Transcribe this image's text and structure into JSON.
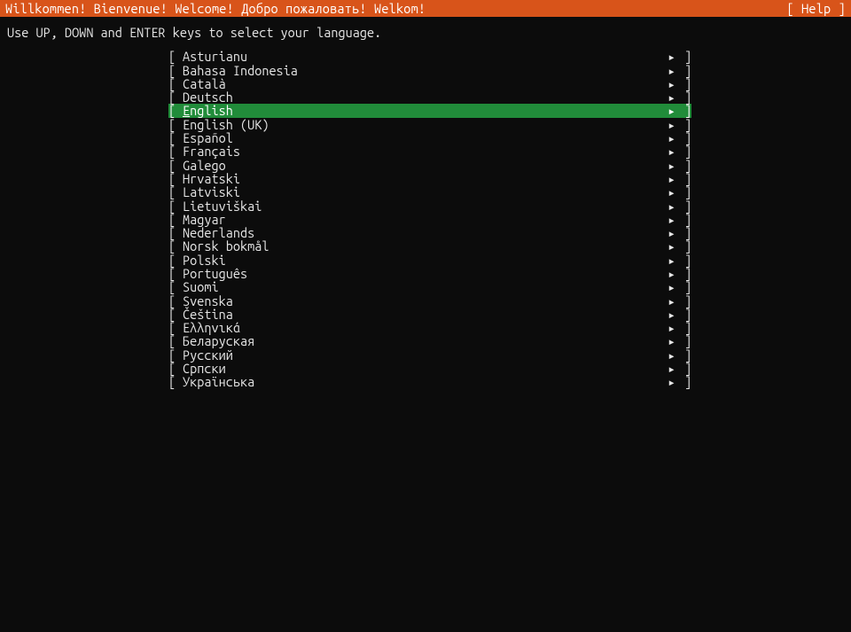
{
  "header": {
    "title": "Willkommen! Bienvenue! Welcome! Добро пожаловать! Welkom!",
    "help": "[ Help ]"
  },
  "instruction": "Use UP, DOWN and ENTER keys to select your language.",
  "glyphs": {
    "left_bracket": "[ ",
    "right_bracket": " ]",
    "arrow": "▸"
  },
  "selected_index": 4,
  "languages": [
    "Asturianu",
    "Bahasa Indonesia",
    "Català",
    "Deutsch",
    "English",
    "English (UK)",
    "Español",
    "Français",
    "Galego",
    "Hrvatski",
    "Latviski",
    "Lietuviškai",
    "Magyar",
    "Nederlands",
    "Norsk bokmål",
    "Polski",
    "Português",
    "Suomi",
    "Svenska",
    "Čeština",
    "Ελληνικά",
    "Беларуская",
    "Русский",
    "Српски",
    "Українська"
  ]
}
